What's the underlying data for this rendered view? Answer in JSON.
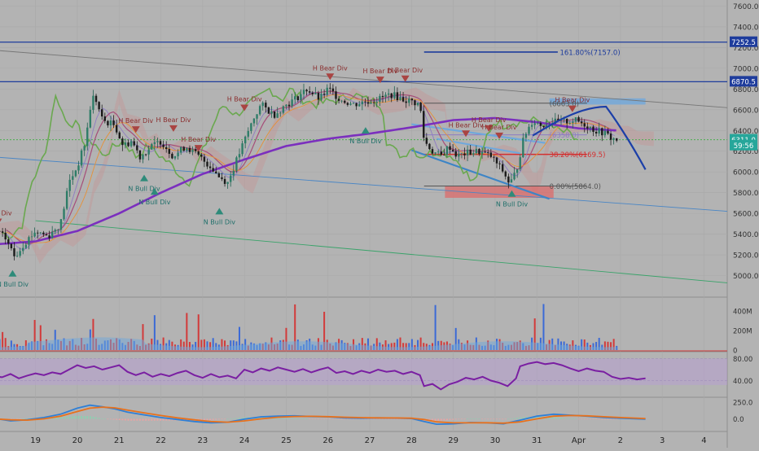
{
  "chart_data": {
    "type": "candlestick",
    "x_tick_labels": [
      "19",
      "20",
      "21",
      "22",
      "23",
      "24",
      "25",
      "26",
      "27",
      "28",
      "29",
      "30",
      "31",
      "Apr",
      "2",
      "3",
      "4"
    ],
    "price_axis": {
      "ticks": [
        7600,
        7400,
        7200,
        7000,
        6800,
        6600,
        6400,
        6200,
        6000,
        5800,
        5600,
        5400,
        5200,
        5000
      ],
      "tick_labels": [
        "7600.0",
        "7400.0",
        "7200.0",
        "7000.0",
        "6800.0",
        "6600.0",
        "6400.0",
        "6200.0",
        "6000.0",
        "5800.0",
        "5600.0",
        "5400.0",
        "5200.0",
        "5000.0"
      ],
      "ylim": [
        4840,
        7680
      ]
    },
    "price_badges": [
      {
        "label": "7252.5",
        "value": 7252.5,
        "color": "#1e3c9c"
      },
      {
        "label": "6870.5",
        "value": 6870.5,
        "color": "#1e3c9c"
      },
      {
        "label": "6311.0",
        "value": 6311.0,
        "color": "#26a69a"
      },
      {
        "label": "59:56",
        "value": 6255,
        "color": "#26a69a"
      }
    ],
    "horizontal_levels": [
      {
        "value": 7252.5,
        "color": "#1e3c9c"
      },
      {
        "value": 6870.5,
        "color": "#1e3c9c"
      },
      {
        "value": 6311.0,
        "color": "#4caf50",
        "style": "dotted"
      }
    ],
    "fib_levels": [
      {
        "label": "161.80%(7157.0)",
        "value": 7157.0,
        "color": "#1e3c9c"
      },
      {
        "label": "(6663.0)",
        "value": 6663.0,
        "color": "#555555"
      },
      {
        "label": "(6358.0)",
        "value": 6358.0,
        "color": "#8e7cc3"
      },
      {
        "label": "38.20%(6169.5)",
        "value": 6169.5,
        "color": "#d32f2f"
      },
      {
        "label": "0.00%(5864.0)",
        "value": 5864.0,
        "color": "#555555"
      }
    ],
    "signals": [
      {
        "label": "Bear Div",
        "kind": "bear",
        "day": 18.1,
        "price": 5550
      },
      {
        "label": "H Bear Div",
        "kind": "bear",
        "day": 21.4,
        "price": 6440
      },
      {
        "label": "H Bear Div",
        "kind": "bear",
        "day": 22.3,
        "price": 6450
      },
      {
        "label": "H Bear Div",
        "kind": "bear",
        "day": 22.9,
        "price": 6260
      },
      {
        "label": "H Bear Div",
        "kind": "bear",
        "day": 24.0,
        "price": 6650
      },
      {
        "label": "H Bear Div",
        "kind": "bear",
        "day": 26.05,
        "price": 6950
      },
      {
        "label": "H Bear Div",
        "kind": "bear",
        "day": 27.25,
        "price": 6920
      },
      {
        "label": "H Bear Div",
        "kind": "bear",
        "day": 27.85,
        "price": 6930
      },
      {
        "label": "H Bear Div",
        "kind": "bear",
        "day": 29.85,
        "price": 6450
      },
      {
        "label": "H Bear Div",
        "kind": "bear",
        "day": 29.3,
        "price": 6400
      },
      {
        "label": "H Bear Div",
        "kind": "bear",
        "day": 30.1,
        "price": 6380
      },
      {
        "label": "H Bear Div",
        "kind": "bear",
        "day": 31.85,
        "price": 6640
      },
      {
        "label": "N Bull Div",
        "kind": "bull",
        "day": 18.45,
        "price": 4990
      },
      {
        "label": "N Bull Div",
        "kind": "bull",
        "day": 21.6,
        "price": 5910
      },
      {
        "label": "N Bull Div",
        "kind": "bull",
        "day": 21.85,
        "price": 5780
      },
      {
        "label": "N Bull Div",
        "kind": "bull",
        "day": 23.4,
        "price": 5590
      },
      {
        "label": "N Bull Div",
        "kind": "bull",
        "day": 26.9,
        "price": 6370
      },
      {
        "label": "N Bull Div",
        "kind": "bull",
        "day": 30.4,
        "price": 5760
      }
    ],
    "volume_axis": {
      "ticks": [
        400,
        200,
        0
      ],
      "tick_labels": [
        "400M",
        "200M",
        "0"
      ],
      "ylim": [
        0,
        460
      ]
    },
    "rsi_axis": {
      "ticks": [
        80,
        40
      ],
      "tick_labels": [
        "80.00",
        "40.00"
      ],
      "ylim": [
        0,
        90
      ]
    },
    "macd_axis": {
      "ticks": [
        250,
        0
      ],
      "tick_labels": [
        "250.0",
        "0.0"
      ],
      "ylim": [
        -110,
        300
      ]
    },
    "rsi_series": [
      [
        18.0,
        48
      ],
      [
        18.2,
        46
      ],
      [
        18.4,
        52
      ],
      [
        18.6,
        44
      ],
      [
        18.8,
        49
      ],
      [
        19.0,
        53
      ],
      [
        19.2,
        50
      ],
      [
        19.4,
        55
      ],
      [
        19.6,
        52
      ],
      [
        19.8,
        60
      ],
      [
        20.0,
        68
      ],
      [
        20.2,
        63
      ],
      [
        20.4,
        66
      ],
      [
        20.6,
        60
      ],
      [
        20.8,
        64
      ],
      [
        21.0,
        68
      ],
      [
        21.2,
        56
      ],
      [
        21.4,
        50
      ],
      [
        21.6,
        55
      ],
      [
        21.8,
        47
      ],
      [
        22.0,
        52
      ],
      [
        22.2,
        48
      ],
      [
        22.4,
        54
      ],
      [
        22.6,
        58
      ],
      [
        22.8,
        50
      ],
      [
        23.0,
        45
      ],
      [
        23.2,
        52
      ],
      [
        23.4,
        46
      ],
      [
        23.6,
        49
      ],
      [
        23.8,
        44
      ],
      [
        24.0,
        60
      ],
      [
        24.2,
        55
      ],
      [
        24.4,
        62
      ],
      [
        24.6,
        58
      ],
      [
        24.8,
        64
      ],
      [
        25.0,
        60
      ],
      [
        25.2,
        56
      ],
      [
        25.4,
        61
      ],
      [
        25.6,
        55
      ],
      [
        25.8,
        60
      ],
      [
        26.0,
        64
      ],
      [
        26.2,
        54
      ],
      [
        26.4,
        57
      ],
      [
        26.6,
        52
      ],
      [
        26.8,
        58
      ],
      [
        27.0,
        54
      ],
      [
        27.2,
        60
      ],
      [
        27.4,
        56
      ],
      [
        27.6,
        58
      ],
      [
        27.8,
        52
      ],
      [
        28.0,
        56
      ],
      [
        28.2,
        50
      ],
      [
        28.3,
        30
      ],
      [
        28.5,
        34
      ],
      [
        28.7,
        24
      ],
      [
        28.9,
        33
      ],
      [
        29.1,
        38
      ],
      [
        29.3,
        45
      ],
      [
        29.5,
        42
      ],
      [
        29.7,
        47
      ],
      [
        29.9,
        40
      ],
      [
        30.1,
        36
      ],
      [
        30.3,
        30
      ],
      [
        30.5,
        44
      ],
      [
        30.6,
        66
      ],
      [
        30.8,
        71
      ],
      [
        31.0,
        74
      ],
      [
        31.2,
        70
      ],
      [
        31.4,
        72
      ],
      [
        31.6,
        68
      ],
      [
        31.8,
        62
      ],
      [
        32.0,
        57
      ],
      [
        32.2,
        62
      ],
      [
        32.4,
        58
      ],
      [
        32.6,
        56
      ],
      [
        32.8,
        47
      ],
      [
        33.0,
        43
      ],
      [
        33.2,
        45
      ],
      [
        33.4,
        42
      ],
      [
        33.6,
        44
      ]
    ],
    "macd_series": [
      [
        18.0,
        10
      ],
      [
        18.4,
        -30
      ],
      [
        18.8,
        -15
      ],
      [
        19.2,
        20
      ],
      [
        19.6,
        70
      ],
      [
        20.0,
        160
      ],
      [
        20.3,
        205
      ],
      [
        20.6,
        180
      ],
      [
        20.9,
        150
      ],
      [
        21.2,
        100
      ],
      [
        21.6,
        60
      ],
      [
        22.0,
        20
      ],
      [
        22.4,
        -10
      ],
      [
        22.8,
        -40
      ],
      [
        23.2,
        -60
      ],
      [
        23.6,
        -50
      ],
      [
        24.0,
        -5
      ],
      [
        24.4,
        30
      ],
      [
        24.8,
        40
      ],
      [
        25.2,
        45
      ],
      [
        25.6,
        35
      ],
      [
        26.0,
        30
      ],
      [
        26.4,
        15
      ],
      [
        26.8,
        10
      ],
      [
        27.2,
        15
      ],
      [
        27.6,
        12
      ],
      [
        28.0,
        5
      ],
      [
        28.3,
        -40
      ],
      [
        28.6,
        -80
      ],
      [
        29.0,
        -75
      ],
      [
        29.4,
        -55
      ],
      [
        29.8,
        -60
      ],
      [
        30.2,
        -75
      ],
      [
        30.6,
        -20
      ],
      [
        31.0,
        40
      ],
      [
        31.4,
        70
      ],
      [
        31.8,
        55
      ],
      [
        32.2,
        40
      ],
      [
        32.6,
        20
      ],
      [
        33.0,
        10
      ],
      [
        33.6,
        -5
      ]
    ],
    "signal_series": [
      [
        18.0,
        0
      ],
      [
        18.4,
        -15
      ],
      [
        18.8,
        -20
      ],
      [
        19.2,
        0
      ],
      [
        19.6,
        40
      ],
      [
        20.0,
        110
      ],
      [
        20.3,
        160
      ],
      [
        20.6,
        175
      ],
      [
        20.9,
        165
      ],
      [
        21.2,
        130
      ],
      [
        21.6,
        90
      ],
      [
        22.0,
        50
      ],
      [
        22.4,
        15
      ],
      [
        22.8,
        -15
      ],
      [
        23.2,
        -40
      ],
      [
        23.6,
        -50
      ],
      [
        24.0,
        -30
      ],
      [
        24.4,
        0
      ],
      [
        24.8,
        25
      ],
      [
        25.2,
        35
      ],
      [
        25.6,
        38
      ],
      [
        26.0,
        33
      ],
      [
        26.4,
        25
      ],
      [
        26.8,
        18
      ],
      [
        27.2,
        15
      ],
      [
        27.6,
        14
      ],
      [
        28.0,
        10
      ],
      [
        28.3,
        -10
      ],
      [
        28.6,
        -45
      ],
      [
        29.0,
        -60
      ],
      [
        29.4,
        -60
      ],
      [
        29.8,
        -58
      ],
      [
        30.2,
        -65
      ],
      [
        30.6,
        -45
      ],
      [
        31.0,
        0
      ],
      [
        31.4,
        40
      ],
      [
        31.8,
        50
      ],
      [
        32.2,
        45
      ],
      [
        32.6,
        32
      ],
      [
        33.0,
        20
      ],
      [
        33.6,
        5
      ]
    ]
  }
}
